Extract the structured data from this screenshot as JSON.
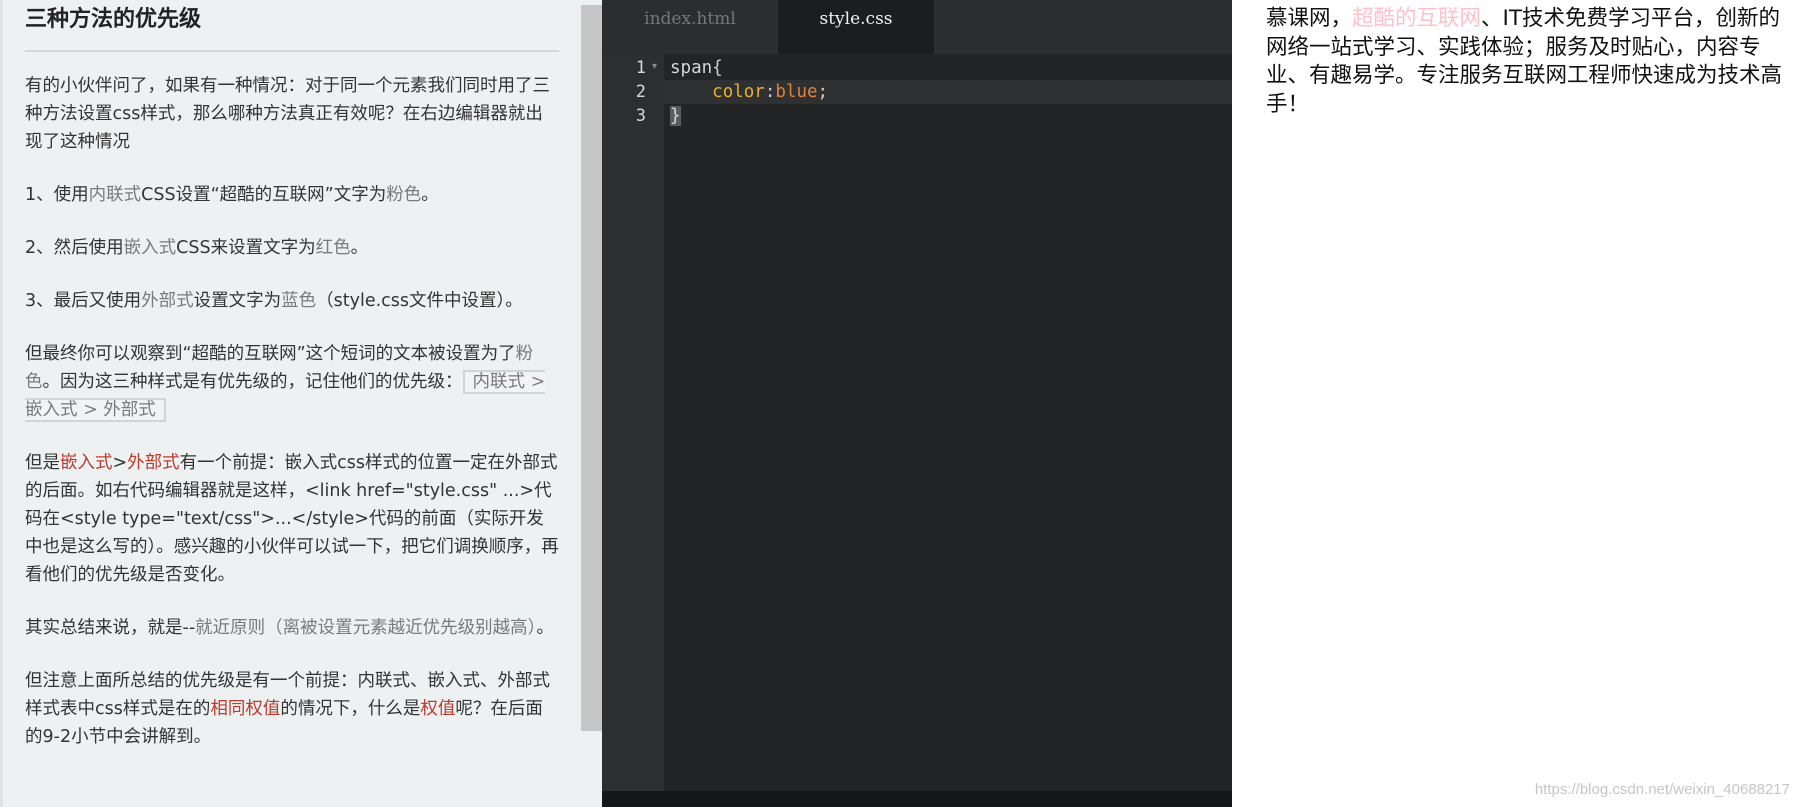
{
  "lesson": {
    "title": "三种方法的优先级",
    "p1": "有的小伙伴问了，如果有一种情况：对于同一个元素我们同时用了三种方法设置css样式，那么哪种方法真正有效呢？在右边编辑器就出现了这种情况",
    "s1": {
      "a": "1、使用",
      "b": "内联式",
      "c": "CSS设置“超酷的互联网”文字为",
      "d": "粉色",
      "e": "。"
    },
    "s2": {
      "a": "2、然后使用",
      "b": "嵌入式",
      "c": "CSS来设置文字为",
      "d": "红色",
      "e": "。"
    },
    "s3": {
      "a": "3、最后又使用",
      "b": "外部式",
      "c": "设置文字为",
      "d": "蓝色",
      "e": "（style.css文件中设置）。"
    },
    "p5": {
      "a": "但最终你可以观察到“超酷的互联网”这个短词的文本被设置为了",
      "b": "粉色",
      "c": "。因为这三种样式是有优先级的，记住他们的优先级：",
      "code": "内联式 > 嵌入式 > 外部式"
    },
    "p6": {
      "a": "但是",
      "b": "嵌入式",
      "c": ">",
      "d": "外部式",
      "e": "有一个前提：嵌入式css样式的位置一定在外部式的后面。如右代码编辑器就是这样，<link href=\"style.css\" ...>代码在<style type=\"text/css\">...</style>代码的前面（实际开发中也是这么写的）。感兴趣的小伙伴可以试一下，把它们调换顺序，再看他们的优先级是否变化。"
    },
    "p7": {
      "a": "其实总结来说，就是--",
      "b": "就近原则（离被设置元素越近优先级别越高）",
      "c": "。"
    },
    "p8": {
      "a": "但注意上面所总结的优先级是有一个前提：内联式、嵌入式、外部式样式表中css样式是在的",
      "b": "相同权值",
      "c": "的情况下，什么是",
      "d": "权值",
      "e": "呢？在后面的9-2小节中会讲解到。"
    }
  },
  "editor": {
    "tabs": [
      "index.html",
      "style.css"
    ],
    "active_tab": "style.css",
    "line_numbers": [
      "1",
      "2",
      "3"
    ],
    "code": {
      "l1_selector": "span",
      "l1_brace": "{",
      "l2_indent": "    ",
      "l2_prop": "color",
      "l2_colon": ":",
      "l2_value": "blue",
      "l2_semi": ";",
      "l3_brace": "}"
    }
  },
  "preview": {
    "a": "慕课网，",
    "b": "超酷的互联网",
    "c": "、IT技术免费学习平台，创新的网络一站式学习、实践体验；服务及时贴心，内容专业、有趣易学。专注服务互联网工程师快速成为技术高手！",
    "watermark": "https://blog.csdn.net/weixin_40688217"
  }
}
